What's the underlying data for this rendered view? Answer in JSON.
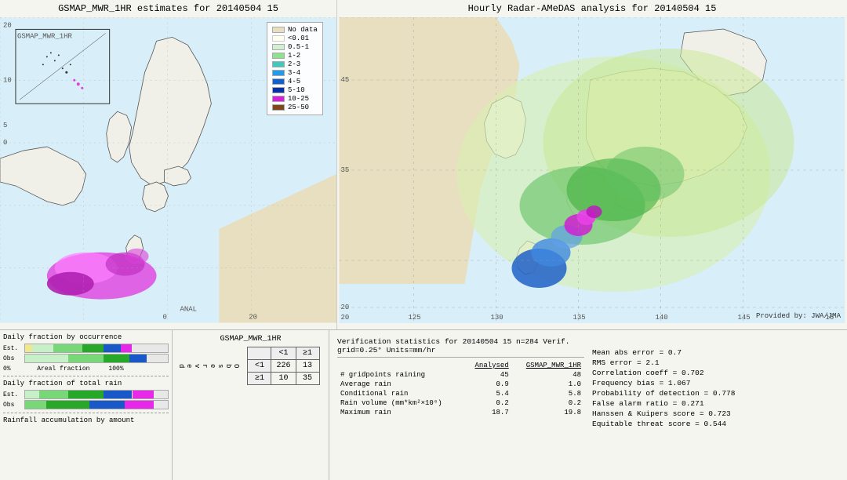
{
  "left_map": {
    "title": "GSMAP_MWR_1HR estimates for 20140504 15",
    "axis_labels": {
      "top": "20",
      "left_values": [
        "20",
        "10",
        "5",
        "0"
      ],
      "bottom_values": [
        "0",
        "20"
      ],
      "anal_label": "ANAL"
    },
    "inset_label": "GSMAP_MWR_1HR"
  },
  "right_map": {
    "title": "Hourly Radar-AMeDAS analysis for 20140504 15",
    "lat_labels": [
      "45",
      "35",
      "20"
    ],
    "lon_labels": [
      "125",
      "130",
      "135",
      "140",
      "145",
      "15"
    ],
    "provided_by": "Provided by: JWA/JMA"
  },
  "legend": {
    "title": "",
    "items": [
      {
        "label": "No data",
        "color": "#f5f0d8"
      },
      {
        "label": "<0.01",
        "color": "#fffff0"
      },
      {
        "label": "0.5-1",
        "color": "#e8f8e8"
      },
      {
        "label": "1-2",
        "color": "#b8eeb8"
      },
      {
        "label": "2-3",
        "color": "#78deb8"
      },
      {
        "label": "3-4",
        "color": "#40c8d8"
      },
      {
        "label": "4-5",
        "color": "#2898e8"
      },
      {
        "label": "5-10",
        "color": "#1858c8"
      },
      {
        "label": "10-25",
        "color": "#e828e8"
      },
      {
        "label": "25-50",
        "color": "#885020"
      }
    ]
  },
  "bottom_charts": {
    "title1": "Daily fraction by occurrence",
    "est_label": "Est.",
    "obs_label": "Obs",
    "x_axis": "0%          Areal fraction          100%",
    "title2": "Daily fraction of total rain",
    "title3": "Rainfall accumulation by amount",
    "bars": {
      "occurrence_est": [
        {
          "color": "#f0e890",
          "width": 5
        },
        {
          "color": "#c8f0c8",
          "width": 15
        },
        {
          "color": "#78d878",
          "width": 20
        },
        {
          "color": "#28a828",
          "width": 10
        },
        {
          "color": "#1858c8",
          "width": 8
        },
        {
          "color": "#e828e8",
          "width": 4
        }
      ],
      "occurrence_obs": [
        {
          "color": "#c8f0c8",
          "width": 30
        },
        {
          "color": "#78d878",
          "width": 25
        },
        {
          "color": "#28a828",
          "width": 15
        },
        {
          "color": "#1858c8",
          "width": 10
        }
      ],
      "total_rain_est": [
        {
          "color": "#c8f0c8",
          "width": 10
        },
        {
          "color": "#78d878",
          "width": 20
        },
        {
          "color": "#28a828",
          "width": 25
        },
        {
          "color": "#1858c8",
          "width": 20
        },
        {
          "color": "#e828e8",
          "width": 15
        }
      ],
      "total_rain_obs": [
        {
          "color": "#78d878",
          "width": 15
        },
        {
          "color": "#28a828",
          "width": 30
        },
        {
          "color": "#1858c8",
          "width": 25
        },
        {
          "color": "#e828e8",
          "width": 20
        }
      ]
    }
  },
  "contingency": {
    "title": "GSMAP_MWR_1HR",
    "col_headers": [
      "<1",
      "≥1"
    ],
    "row_headers": [
      "<1",
      "≥1"
    ],
    "obs_label": "O\nb\ns\ne\nr\nv\ne\nd",
    "values": [
      [
        226,
        13
      ],
      [
        10,
        35
      ]
    ]
  },
  "verification": {
    "header": "Verification statistics for 20140504 15  n=284  Verif. grid=0.25°  Units=mm/hr",
    "col_headers": [
      "Analysed",
      "GSMAP_MWR_1HR"
    ],
    "rows": [
      {
        "label": "# gridpoints raining",
        "analysed": "45",
        "gsmap": "48"
      },
      {
        "label": "Average rain",
        "analysed": "0.9",
        "gsmap": "1.0"
      },
      {
        "label": "Conditional rain",
        "analysed": "5.4",
        "gsmap": "5.8"
      },
      {
        "label": "Rain volume (mm*km²×10⁶)",
        "analysed": "0.2",
        "gsmap": "0.2"
      },
      {
        "label": "Maximum rain",
        "analysed": "18.7",
        "gsmap": "19.8"
      }
    ],
    "stats": [
      "Mean abs error = 0.7",
      "RMS error = 2.1",
      "Correlation coeff = 0.702",
      "Frequency bias = 1.067",
      "Probability of detection = 0.778",
      "False alarm ratio = 0.271",
      "Hanssen & Kuipers score = 0.723",
      "Equitable threat score = 0.544"
    ]
  }
}
